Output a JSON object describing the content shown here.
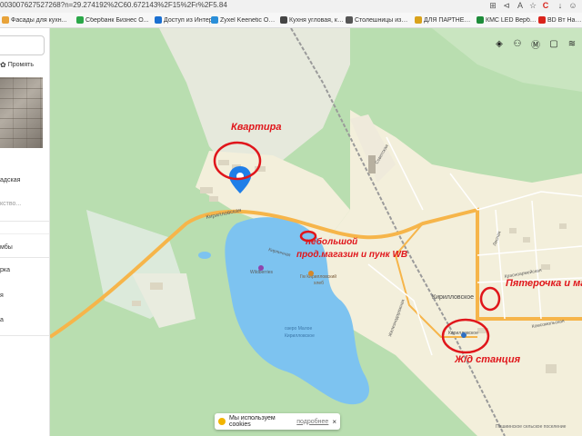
{
  "browser": {
    "url": "003007627527268?n=29.274192%2C60.672143%2F15%2Fr%2F5.84",
    "bookmarks": [
      {
        "label": "Фасады для кухн...",
        "color": "#e8a33a"
      },
      {
        "label": "Сбербанк Бизнес О...",
        "color": "#2aa748"
      },
      {
        "label": "Доступ из Интерне...",
        "color": "#1a6fd1"
      },
      {
        "label": "Zyxel Keenetic Omn...",
        "color": "#2a8ed8"
      },
      {
        "label": "Кухня угловая, кух...",
        "color": "#444444"
      },
      {
        "label": "Столешницы из ма...",
        "color": "#555555"
      },
      {
        "label": "ДЛЯ ПАРТНЕРОВ",
        "color": "#d9a21b"
      },
      {
        "label": "КМС LED Вербл-1 |...",
        "color": "#1e8c3a"
      },
      {
        "label": "BD Bт Наствч",
        "color": "#d9231b"
      }
    ]
  },
  "sidebar": {
    "panorama_label": "Промять",
    "text_1": "адская",
    "text_2": "кство...",
    "item_1": "мбы",
    "item_2": "рка",
    "item_3": "я",
    "item_4": "а"
  },
  "map": {
    "labels": {
      "station_name": "Кирилловское",
      "station_stop": "Кирилловское",
      "lake": "озеро Малое Кирилловское",
      "lake_l1": "озеро Малое",
      "lake_l2": "Кирилловское",
      "highway": "Кирилловская",
      "wildberries": "Wildberries",
      "shop": "Гм Кирилловский хлеб",
      "shop_l1": "Гм Кирилловский",
      "shop_l2": "хлеб",
      "street_1": "Лесная",
      "street_2": "Красноармейская",
      "street_3": "Железнодорожная",
      "street_4": "Комсомольская",
      "street_5": "Советская",
      "street_6": "Садовая",
      "street_7": "Кирпичная",
      "bottom_right": "Пашиинское сельское поселение",
      "village": "Кирилловское"
    },
    "annotations": {
      "apartment": "Квартира",
      "shop_line1": "небольшой",
      "shop_line2": "прод.магазин и пунк WB",
      "pyaterochka": "Пятерочка и ма",
      "station": "Ж/д станция"
    }
  },
  "cookie": {
    "text": "Мы используем cookies",
    "more": "подробнее",
    "close": "×"
  },
  "colors": {
    "forest": "#b9deb0",
    "field": "#e9ecdf",
    "village": "#f3efdb",
    "water": "#7dc3f0",
    "road": "#f6b54a",
    "annotation": "#e0161b"
  }
}
